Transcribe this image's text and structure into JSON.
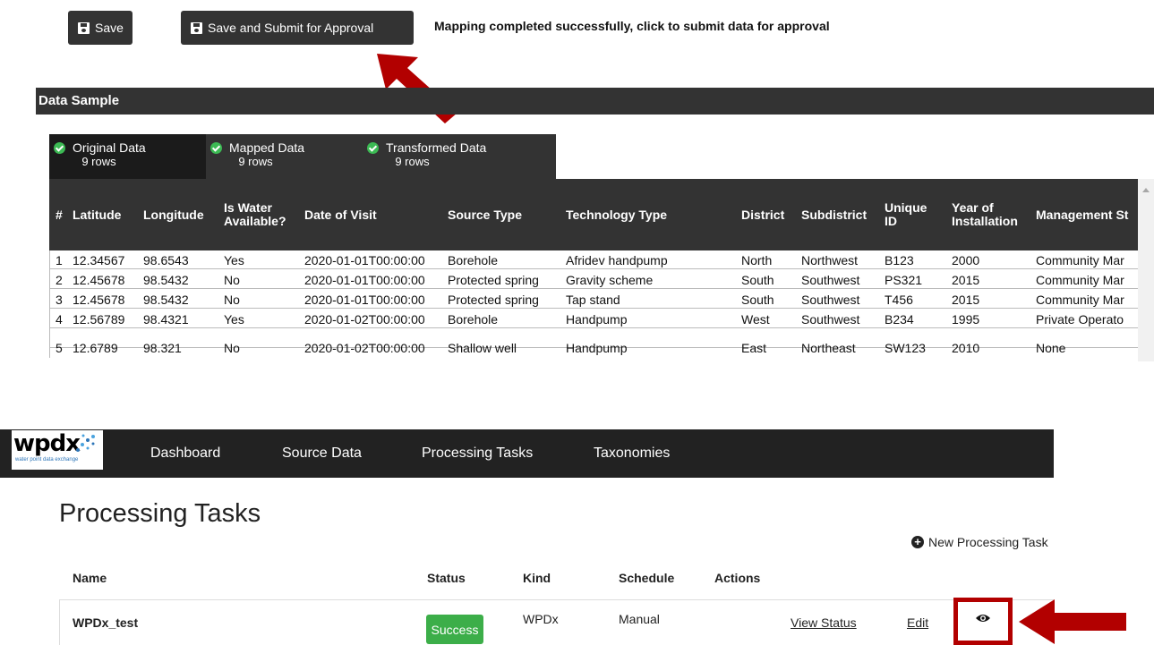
{
  "toolbar": {
    "save_label": "Save",
    "submit_label": "Save and Submit for Approval",
    "status_message": "Mapping completed successfully, click to submit data for approval"
  },
  "data_sample": {
    "title": "Data Sample",
    "tabs": [
      {
        "label": "Original Data",
        "rows": "9 rows",
        "active": true
      },
      {
        "label": "Mapped Data",
        "rows": "9 rows",
        "active": false
      },
      {
        "label": "Transformed Data",
        "rows": "9 rows",
        "active": false
      }
    ],
    "columns": [
      "#",
      "Latitude",
      "Longitude",
      "Is Water Available?",
      "Date of Visit",
      "Source Type",
      "Technology Type",
      "District",
      "Subdistrict",
      "Unique ID",
      "Year of Installation",
      "Management St"
    ],
    "rows": [
      [
        "1",
        "12.34567",
        "98.6543",
        "Yes",
        "2020-01-01T00:00:00",
        "Borehole",
        "Afridev handpump",
        "North",
        "Northwest",
        "B123",
        "2000",
        "Community Mar"
      ],
      [
        "2",
        "12.45678",
        "98.5432",
        "No",
        "2020-01-01T00:00:00",
        "Protected spring",
        "Gravity scheme",
        "South",
        "Southwest",
        "PS321",
        "2015",
        "Community Mar"
      ],
      [
        "3",
        "12.45678",
        "98.5432",
        "No",
        "2020-01-01T00:00:00",
        "Protected spring",
        "Tap stand",
        "South",
        "Southwest",
        "T456",
        "2015",
        "Community Mar"
      ],
      [
        "4",
        "12.56789",
        "98.4321",
        "Yes",
        "2020-01-02T00:00:00",
        "Borehole",
        "Handpump",
        "West",
        "Southwest",
        "B234",
        "1995",
        "Private Operato"
      ],
      [
        "5",
        "12.6789",
        "98.321",
        "No",
        "2020-01-02T00:00:00",
        "Shallow well",
        "Handpump",
        "East",
        "Northeast",
        "SW123",
        "2010",
        "None"
      ]
    ]
  },
  "app": {
    "logo_text": "wpdx",
    "logo_tagline": "water point data exchange",
    "nav": [
      "Dashboard",
      "Source Data",
      "Processing Tasks",
      "Taxonomies"
    ]
  },
  "processing_tasks": {
    "title": "Processing Tasks",
    "new_task_label": "New Processing Task",
    "columns": [
      "Name",
      "Status",
      "Kind",
      "Schedule",
      "Actions"
    ],
    "row": {
      "name": "WPDx_test",
      "status": "Success",
      "kind": "WPDx",
      "schedule": "Manual",
      "view_status": "View Status",
      "edit": "Edit"
    }
  },
  "colors": {
    "dark_bar": "#333333",
    "success_green": "#3cae49",
    "highlight_red": "#b20000"
  },
  "icons": [
    "save-icon",
    "check-circle-icon",
    "plus-circle-icon",
    "eye-icon"
  ]
}
